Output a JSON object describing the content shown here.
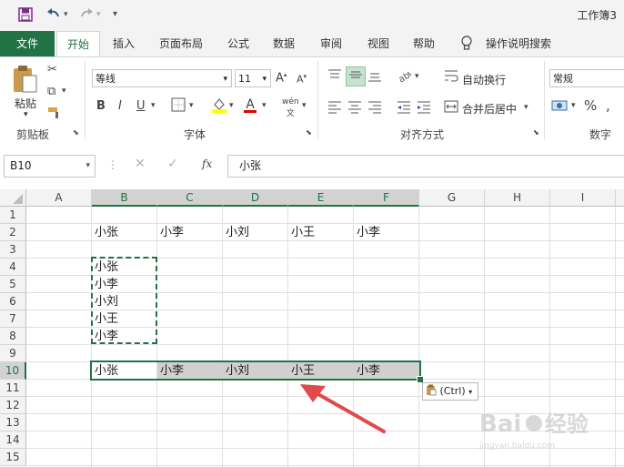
{
  "window": {
    "title": "工作簿3"
  },
  "tabs": [
    {
      "label": "文件"
    },
    {
      "label": "开始"
    },
    {
      "label": "插入"
    },
    {
      "label": "页面布局"
    },
    {
      "label": "公式"
    },
    {
      "label": "数据"
    },
    {
      "label": "审阅"
    },
    {
      "label": "视图"
    },
    {
      "label": "帮助"
    },
    {
      "label": "操作说明搜索"
    }
  ],
  "ribbon": {
    "clipboard": {
      "paste_label": "粘贴",
      "group_label": "剪贴板"
    },
    "font": {
      "name": "等线",
      "size": "11",
      "group_label": "字体",
      "bold": "B",
      "italic": "I",
      "underline": "U",
      "color_a": "A"
    },
    "alignment": {
      "wrap_label": "自动换行",
      "merge_label": "合并后居中",
      "group_label": "对齐方式"
    },
    "number": {
      "format": "常规",
      "percent": "%",
      "group_label": "数字"
    }
  },
  "formula_bar": {
    "name_box": "B10",
    "fx": "fx",
    "value": "小张"
  },
  "grid": {
    "columns": [
      "A",
      "B",
      "C",
      "D",
      "E",
      "F",
      "G",
      "H",
      "I"
    ],
    "rows": [
      "1",
      "2",
      "3",
      "4",
      "5",
      "6",
      "7",
      "8",
      "9",
      "10",
      "11",
      "12",
      "13",
      "14",
      "15"
    ],
    "row2": [
      "小张",
      "小李",
      "小刘",
      "小王",
      "小李"
    ],
    "colB_list": [
      "小张",
      "小李",
      "小刘",
      "小王",
      "小李"
    ],
    "row10": [
      "小张",
      "小李",
      "小刘",
      "小王",
      "小李"
    ]
  },
  "paste_options": {
    "label": "(Ctrl)"
  },
  "colors": {
    "accent": "#217346",
    "arrow": "#e04a4a"
  }
}
